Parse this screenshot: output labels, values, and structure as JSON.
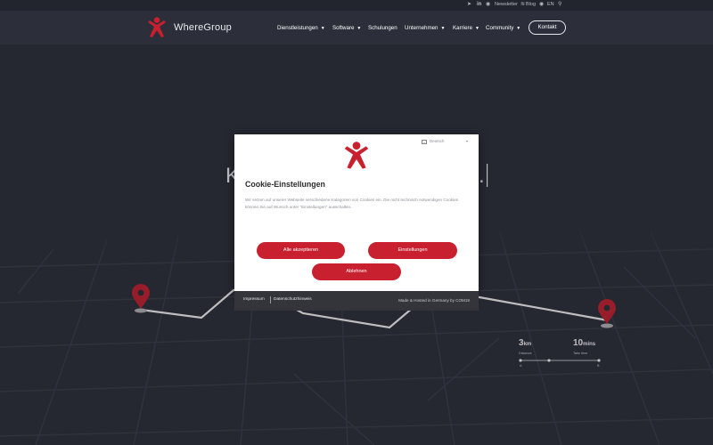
{
  "topbar": {
    "newsletter": "Newsletter",
    "blog": "Blog",
    "lang": "EN",
    "icons": [
      "telegram-icon",
      "linkedin-icon",
      "mastodon-icon",
      "rss-icon",
      "globe-icon",
      "search-icon"
    ]
  },
  "brand": {
    "name": "WhereGroup",
    "accent": "#c8202f"
  },
  "nav": {
    "items": [
      {
        "label": "Dienstleistungen",
        "has_dropdown": true
      },
      {
        "label": "Software",
        "has_dropdown": true
      },
      {
        "label": "Schulungen",
        "has_dropdown": false
      },
      {
        "label": "Unternehmen",
        "has_dropdown": true
      },
      {
        "label": "Karriere",
        "has_dropdown": true
      },
      {
        "label": "Community",
        "has_dropdown": true
      }
    ],
    "contact": "Kontakt"
  },
  "hero": {
    "stats": [
      {
        "value": "3",
        "unit": "km",
        "label": "Distance"
      },
      {
        "value": "10",
        "unit": "mins",
        "label": "Take time"
      }
    ],
    "route_labels": [
      "A",
      "B"
    ]
  },
  "cookie": {
    "language": "Deutsch",
    "title": "Cookie-Einstellungen",
    "text": "Wir setzen auf unserer Webseite verschiedene Kategorien von Cookies ein. Die nicht technisch notwendigen Cookies können Sie auf Wunsch unter \"Einstellungen\" ausschalten.",
    "accept": "Alle akzeptieren",
    "settings": "Einstellungen",
    "decline": "Ablehnen",
    "footer": {
      "imprint": "Impressum",
      "privacy": "Datenschutzhinweis",
      "made": "Made & Hosted in Germany by COM19"
    }
  }
}
